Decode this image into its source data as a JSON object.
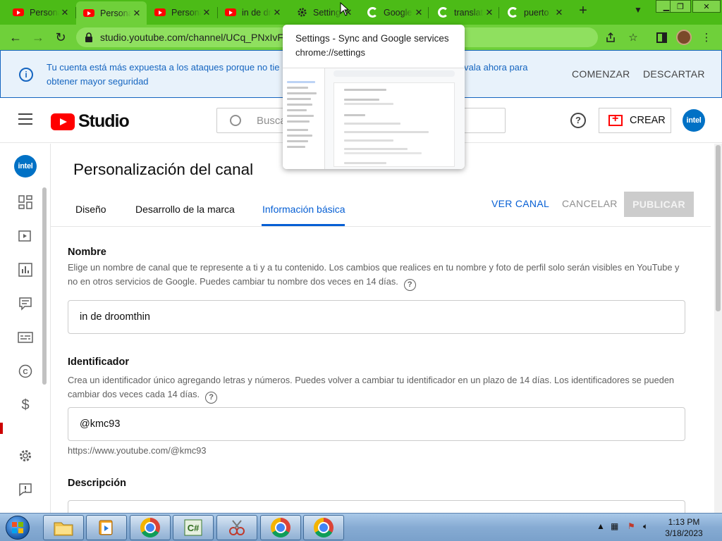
{
  "browser": {
    "tabs": [
      {
        "label": "Personalización del canal",
        "icon": "youtube-icon"
      },
      {
        "label": "Personalización del canal",
        "icon": "youtube-icon"
      },
      {
        "label": "Personalización del canal",
        "icon": "youtube-icon"
      },
      {
        "label": "in de droomthin",
        "icon": "youtube-icon"
      },
      {
        "label": "Settings",
        "icon": "gear-icon"
      },
      {
        "label": "Google",
        "icon": "google-icon"
      },
      {
        "label": "translate",
        "icon": "google-icon"
      },
      {
        "label": "puerto",
        "icon": "google-icon"
      }
    ],
    "url": "studio.youtube.com/channel/UCq_PNxIvF",
    "hover_card": {
      "title": "Settings - Sync and Google services",
      "url": "chrome://settings"
    }
  },
  "banner": {
    "text_start": "Tu cuenta está más expuesta a los ataques porque no tie",
    "text_end": "ívala ahora para",
    "text_line2": "obtener mayor seguridad",
    "start_label": "COMENZAR",
    "dismiss_label": "DESCARTAR"
  },
  "header": {
    "logo_text": "Studio",
    "search_placeholder": "Busca",
    "create_label": "CREAR",
    "avatar_text": "intel"
  },
  "rail": {
    "avatar_text": "intel"
  },
  "page": {
    "title": "Personalización del canal",
    "tabs": [
      "Diseño",
      "Desarrollo de la marca",
      "Información básica"
    ],
    "view_channel": "VER CANAL",
    "cancel": "CANCELAR",
    "publish": "PUBLICAR"
  },
  "form": {
    "name": {
      "title": "Nombre",
      "description": "Elige un nombre de canal que te represente a ti y a tu contenido. Los cambios que realices en tu nombre y foto de perfil solo serán visibles en YouTube y no en otros servicios de Google. Puedes cambiar tu nombre dos veces en 14 días.",
      "value": "in de droomthin"
    },
    "handle": {
      "title": "Identificador",
      "description": "Crea un identificador único agregando letras y números. Puedes volver a cambiar tu identificador en un plazo de 14 días. Los identificadores se pueden cambiar dos veces cada 14 días.",
      "value": "@kmc93",
      "url_hint": "https://www.youtube.com/@kmc93"
    },
    "description": {
      "title": "Descripción"
    }
  },
  "taskbar": {
    "time": "1:13 PM",
    "date": "3/18/2023"
  },
  "colors": {
    "chrome_frame": "#4cbb17",
    "banner_blue": "#1565c0",
    "youtube_red": "#ff0000",
    "studio_blue": "#065fd4",
    "intel_blue": "#0071c5"
  }
}
